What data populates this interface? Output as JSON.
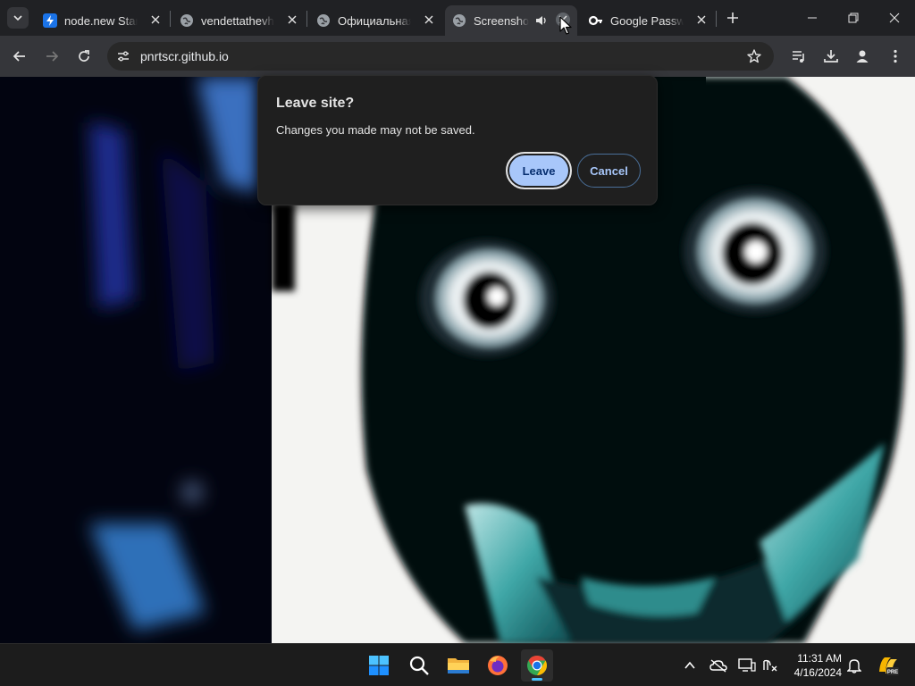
{
  "browser": {
    "tabs": [
      {
        "title": "node.new Starte",
        "favicon": "bolt-icon",
        "active": false
      },
      {
        "title": "vendettathevhs",
        "favicon": "globe-icon",
        "active": false
      },
      {
        "title": "Официальная",
        "favicon": "globe-icon",
        "active": false
      },
      {
        "title": "Screenshot",
        "favicon": "globe-icon",
        "active": true,
        "audio": "speaker-icon"
      },
      {
        "title": "Google Passwo",
        "favicon": "key-icon",
        "active": false
      }
    ],
    "address": "pnrtscr.github.io"
  },
  "dialog": {
    "title": "Leave site?",
    "message": "Changes you made may not be saved.",
    "leave_label": "Leave",
    "cancel_label": "Cancel"
  },
  "taskbar": {
    "apps": [
      "windows-start-icon",
      "search-icon",
      "file-explorer-icon",
      "firefox-icon",
      "chrome-icon"
    ],
    "active_app": "chrome-icon",
    "time": "11:31 AM",
    "date": "4/16/2024",
    "badge": "PRE"
  },
  "colors": {
    "accent": "#a8c7fa",
    "tab_strip": "#202124",
    "toolbar": "#35363a",
    "taskbar": "#1c1c1c"
  }
}
